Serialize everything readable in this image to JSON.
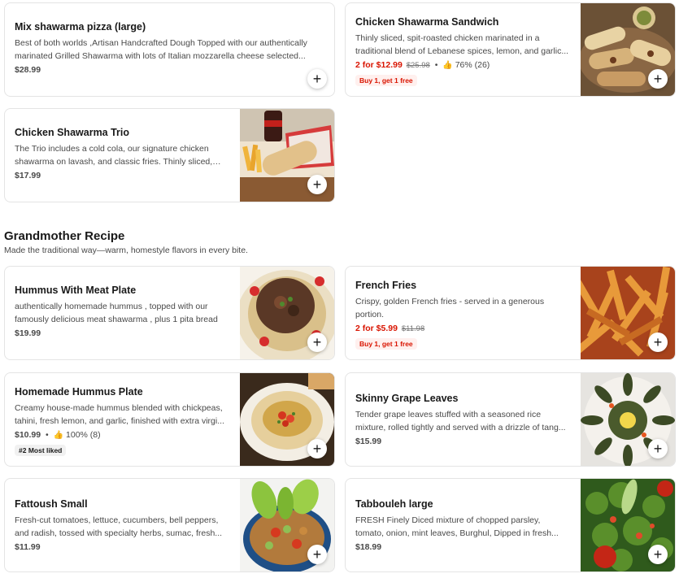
{
  "top_items": [
    {
      "name": "Mix shawarma pizza (large)",
      "description": "Best of both worlds ,Artisan Handcrafted Dough Topped with our authentically marinated Grilled Shawarma with lots of Italian mozzarella cheese selected...",
      "price": "$28.99"
    },
    {
      "name": "Chicken Shawarma Sandwich",
      "description": "Thinly sliced, spit-roasted chicken marinated in a traditional blend of Lebanese spices, lemon, and garlic...",
      "promo_price": "2 for $12.99",
      "original_price": "$25.98",
      "rating": "76% (26)",
      "badge": "Buy 1, get 1 free"
    },
    {
      "name": "Chicken Shawarma Trio",
      "description": "The Trio includes a cold cola, our signature chicken shawarma on lavash, and classic fries. Thinly sliced, spi...",
      "price": "$17.99"
    }
  ],
  "section": {
    "title": "Grandmother Recipe",
    "subtitle": "Made the traditional way—warm, homestyle flavors in every bite."
  },
  "items": [
    {
      "name": "Hummus With Meat Plate",
      "description": "authentically homemade hummus , topped with our famously delicious meat shawarma , plus 1 pita bread",
      "price": "$19.99"
    },
    {
      "name": "French Fries",
      "description": "Crispy, golden French fries - served in a generous portion.",
      "promo_price": "2 for $5.99",
      "original_price": "$11.98",
      "badge": "Buy 1, get 1 free"
    },
    {
      "name": "Homemade Hummus Plate",
      "description": "Creamy house-made hummus blended with chickpeas, tahini, fresh lemon, and garlic, finished with extra virgi...",
      "price": "$10.99",
      "rating": "100% (8)",
      "badge": "#2 Most liked"
    },
    {
      "name": "Skinny Grape Leaves",
      "description": "Tender grape leaves stuffed with a seasoned rice mixture, rolled tightly and served with a drizzle of tang...",
      "price": "$15.99"
    },
    {
      "name": "Fattoush Small",
      "description": "Fresh-cut tomatoes, lettuce, cucumbers, bell peppers, and radish, tossed with specialty herbs, sumac, fresh...",
      "price": "$11.99"
    },
    {
      "name": "Tabbouleh large",
      "description": "FRESH Finely Diced mixture of chopped parsley, tomato, onion, mint leaves, Burghul, Dipped in fresh...",
      "price": "$18.99"
    }
  ],
  "add_button": "+",
  "dot_separator": "•",
  "thumb_icon": "👍",
  "colors": {
    "promo": "#d91400",
    "badge_bg": "#fff0ee",
    "border": "#e4e4e4"
  }
}
